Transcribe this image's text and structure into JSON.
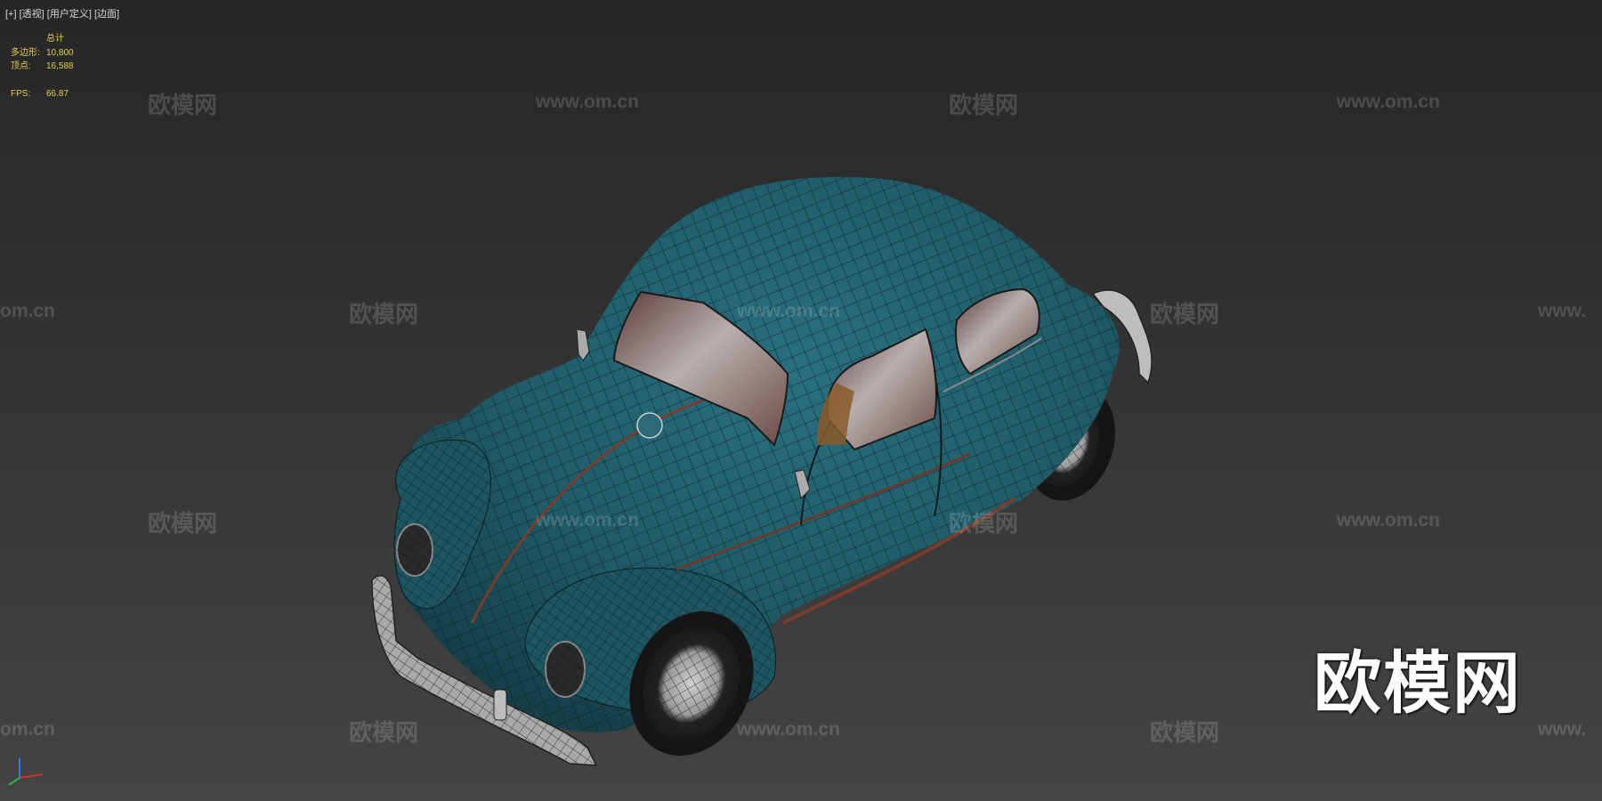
{
  "viewport": {
    "label_plus": "[+]",
    "label_view": "[透视]",
    "label_custom": "[用户定义]",
    "label_shading": "[边面]"
  },
  "stats": {
    "header": "总计",
    "polys_label": "多边形:",
    "polys_value": "10,800",
    "verts_label": "顶点:",
    "verts_value": "16,588",
    "fps_label": "FPS:",
    "fps_value": "66.87"
  },
  "watermarks": {
    "brand": "欧模网",
    "url": "www.om.cn",
    "url_partial_left": "om.cn",
    "url_partial_right": "www."
  },
  "colors": {
    "car_body": "#1f5a66",
    "wire": "#0c1c20",
    "stats_text": "#e2cf55"
  }
}
